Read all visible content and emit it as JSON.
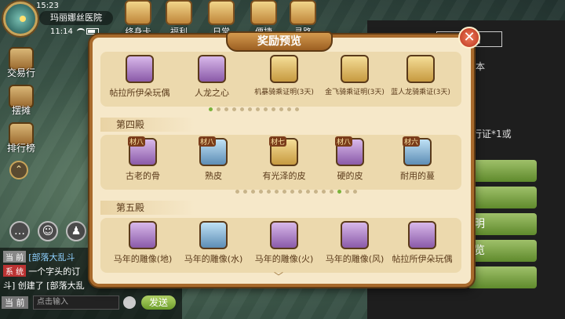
{
  "status": {
    "clock": "15:23",
    "location": "玛丽娜丝医院",
    "time2": "11:14"
  },
  "top_bar": [
    {
      "label": "终身卡",
      "icon": "card-icon"
    },
    {
      "label": "福利",
      "icon": "gift-icon"
    },
    {
      "label": "日常",
      "icon": "daily-icon"
    },
    {
      "label": "便捷",
      "icon": "shortcut-icon"
    },
    {
      "label": "寻路",
      "icon": "path-icon"
    }
  ],
  "side_menu": [
    {
      "label": "交易行",
      "icon": "trade-icon"
    },
    {
      "label": "摆摊",
      "icon": "stall-icon"
    },
    {
      "label": "排行榜",
      "icon": "ranking-icon"
    }
  ],
  "chat": {
    "lines": [
      {
        "tag": "当 前",
        "text": "[部落大乱斗",
        "link": true
      },
      {
        "tag": "系 统",
        "text": "一个字头的订",
        "sys": true
      },
      {
        "tag": "",
        "text": "斗] 创建了 [部落大乱"
      }
    ],
    "channel": "当 前",
    "placeholder": "点击输入",
    "send_label": "发送"
  },
  "right_panel": {
    "title": "[ 绑 ]",
    "texts": [
      "本",
      "行证*1或"
    ],
    "buttons": [
      "",
      "",
      "明",
      "览",
      ""
    ]
  },
  "dialog": {
    "title": "奖励预览",
    "close": "✕",
    "top_items": [
      {
        "label": "帖拉所伊朵玩偶",
        "frame": "purple",
        "icon": "doll-icon"
      },
      {
        "label": "人龙之心",
        "frame": "purple",
        "icon": "dragon-heart-icon"
      },
      {
        "label": "机暴骑乘证明(3天)",
        "frame": "gold",
        "icon": "mount-cert-icon"
      },
      {
        "label": "金飞骑乘证明(3天)",
        "frame": "gold",
        "icon": "mount-cert-icon"
      },
      {
        "label": "蓝人龙骑乘证(3天)",
        "frame": "gold",
        "icon": "mount-cert-icon"
      }
    ],
    "top_page_dots": 12,
    "top_page_active": 0,
    "sections": [
      {
        "title": "第四殿",
        "items": [
          {
            "label": "古老的骨",
            "badge": "材八",
            "frame": "purple",
            "icon": "bone-icon"
          },
          {
            "label": "熟皮",
            "badge": "材八",
            "frame": "blue",
            "icon": "leather-icon"
          },
          {
            "label": "有光泽的皮",
            "badge": "材七",
            "frame": "gold",
            "icon": "shiny-leather-icon"
          },
          {
            "label": "硬的皮",
            "badge": "材八",
            "frame": "purple",
            "icon": "hard-leather-icon"
          },
          {
            "label": "耐用的蔓",
            "badge": "材六",
            "frame": "blue",
            "icon": "vine-icon"
          }
        ],
        "page_dots": 16,
        "page_active": 13
      },
      {
        "title": "第五殿",
        "items": [
          {
            "label": "马年的雕像(地)",
            "badge": "",
            "frame": "purple",
            "icon": "green-dragon-statue-icon"
          },
          {
            "label": "马年的雕像(水)",
            "badge": "",
            "frame": "blue",
            "icon": "blue-dragon-statue-icon"
          },
          {
            "label": "马年的雕像(火)",
            "badge": "",
            "frame": "purple",
            "icon": "red-dragon-statue-icon"
          },
          {
            "label": "马年的雕像(风)",
            "badge": "",
            "frame": "purple",
            "icon": "gold-dragon-statue-icon"
          },
          {
            "label": "帖拉所伊朵玩偶",
            "badge": "",
            "frame": "purple",
            "icon": "doll-icon"
          }
        ]
      }
    ],
    "more_arrow": "﹀"
  }
}
